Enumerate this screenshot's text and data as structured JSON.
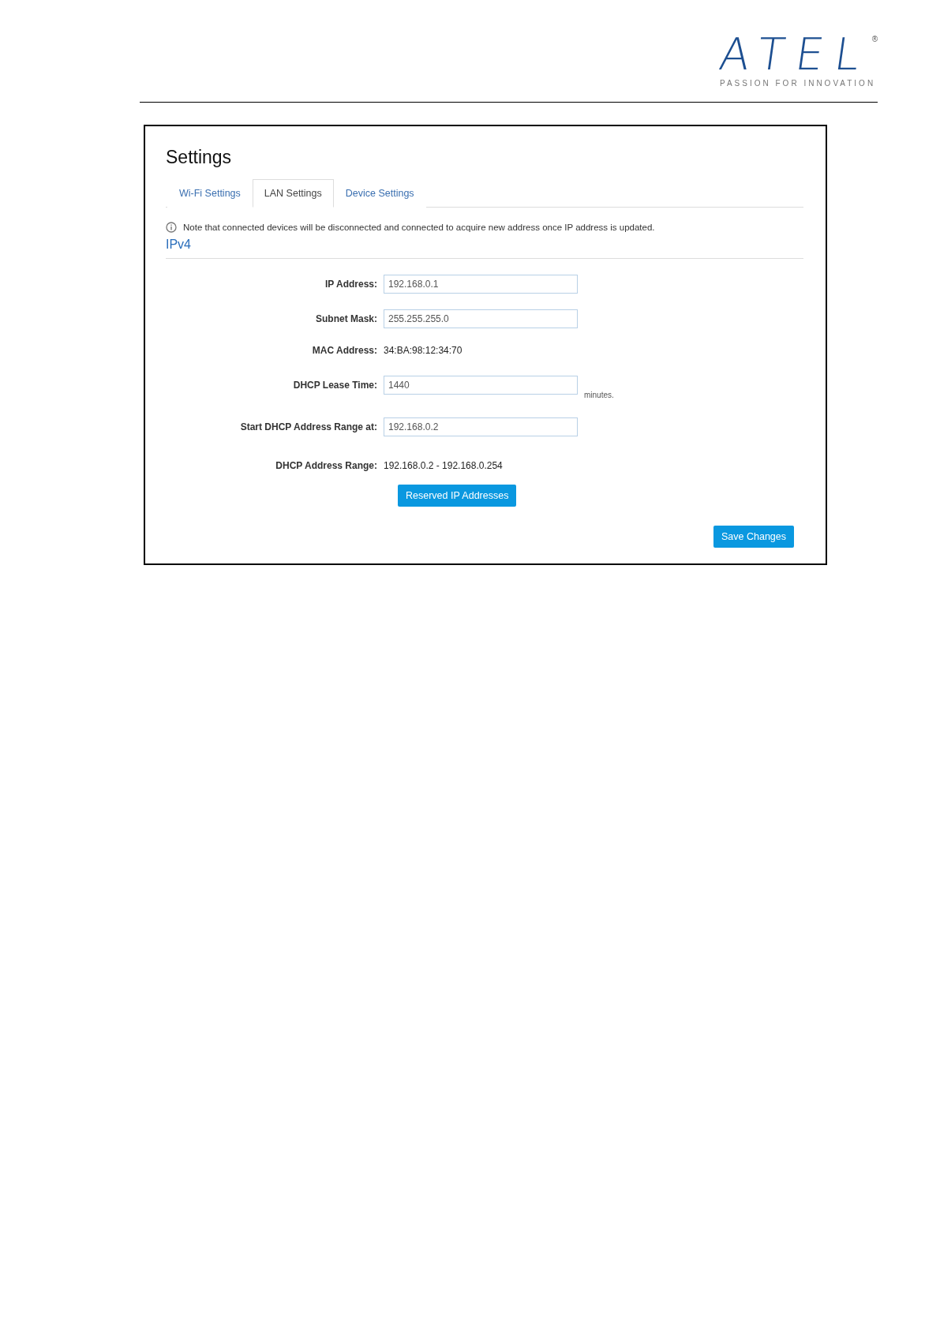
{
  "logo": {
    "name": "ATEL",
    "mark": "®",
    "tagline": "PASSION FOR INNOVATION"
  },
  "settings": {
    "title": "Settings",
    "tabs": [
      {
        "label": "Wi-Fi Settings",
        "selected": false
      },
      {
        "label": "LAN Settings",
        "selected": true
      },
      {
        "label": "Device Settings",
        "selected": false
      }
    ],
    "note": "Note that connected devices will be disconnected and connected to acquire new address once IP address is updated.",
    "section": "IPv4",
    "fields": [
      {
        "kind": "input",
        "label": "IP Address:",
        "value": "192.168.0.1"
      },
      {
        "kind": "input",
        "label": "Subnet Mask:",
        "value": "255.255.255.0"
      },
      {
        "kind": "text",
        "label": "MAC Address:",
        "value": "34:BA:98:12:34:70"
      },
      {
        "kind": "input",
        "label": "DHCP Lease Time:",
        "value": "1440",
        "unit": "minutes."
      },
      {
        "kind": "input",
        "label": "Start DHCP Address Range at:",
        "value": "192.168.0.2"
      },
      {
        "kind": "text",
        "label": "DHCP Address Range:",
        "value": "192.168.0.2 - 192.168.0.254"
      }
    ],
    "reserved_button": "Reserved IP Addresses",
    "save_button": "Save Changes"
  }
}
